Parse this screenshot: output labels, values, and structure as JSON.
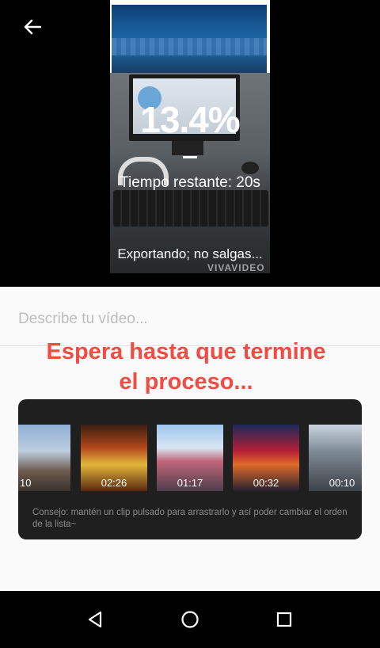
{
  "export": {
    "progress_text": "13.4%",
    "progress": 0.134,
    "remaining_text": "Tiempo restante: 20s",
    "status_text": "Exportando; no salgas...",
    "watermark": "VIVAVIDEO"
  },
  "description": {
    "placeholder": "Describe tu vídeo...",
    "value": ""
  },
  "wait_message": {
    "line1": "Espera hasta que termine",
    "line2": "el proceso..."
  },
  "clips": [
    {
      "duration": "10"
    },
    {
      "duration": "02:26"
    },
    {
      "duration": "01:17"
    },
    {
      "duration": "00:32"
    },
    {
      "duration": "00:10"
    }
  ],
  "tip_text": "Consejo: mantén un clip pulsado para arrastrarlo y así poder cambiar el orden de la lista~",
  "icons": {
    "back": "arrow-left-icon",
    "nav_back": "triangle-back-icon",
    "nav_home": "circle-home-icon",
    "nav_recents": "square-recents-icon"
  },
  "colors": {
    "accent": "#ee4d44",
    "panel": "#1f1f1f",
    "sheet": "#fafafa"
  }
}
